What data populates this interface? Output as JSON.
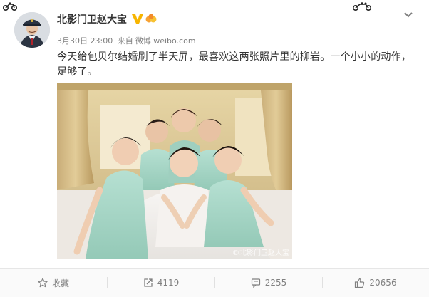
{
  "post": {
    "username": "北影门卫赵大宝",
    "date": "3月30日 23:00",
    "source_prefix": "来自",
    "source": "微博 weibo.com",
    "text": "今天给包贝尔结婚刷了半天屏，最喜欢这两张照片里的柳岩。一个小小的动作，足够了。",
    "image_watermark": "©北影门卫赵大宝"
  },
  "toolbar": {
    "favorite_label": "收藏",
    "share_count": "4119",
    "comment_count": "2255",
    "like_count": "20656"
  },
  "icons": {
    "verified": "v-verified-icon",
    "level": "level-badge-icon",
    "more": "chevron-down-icon",
    "favorite": "star-icon",
    "share": "share-arrow-icon",
    "comment": "comment-icon",
    "like": "thumbs-up-icon"
  },
  "colors": {
    "verified_badge": "#f7b500",
    "meta_text": "#808080",
    "toolbar_bg": "#fafafa",
    "dress_mint": "#a9d9c8"
  }
}
